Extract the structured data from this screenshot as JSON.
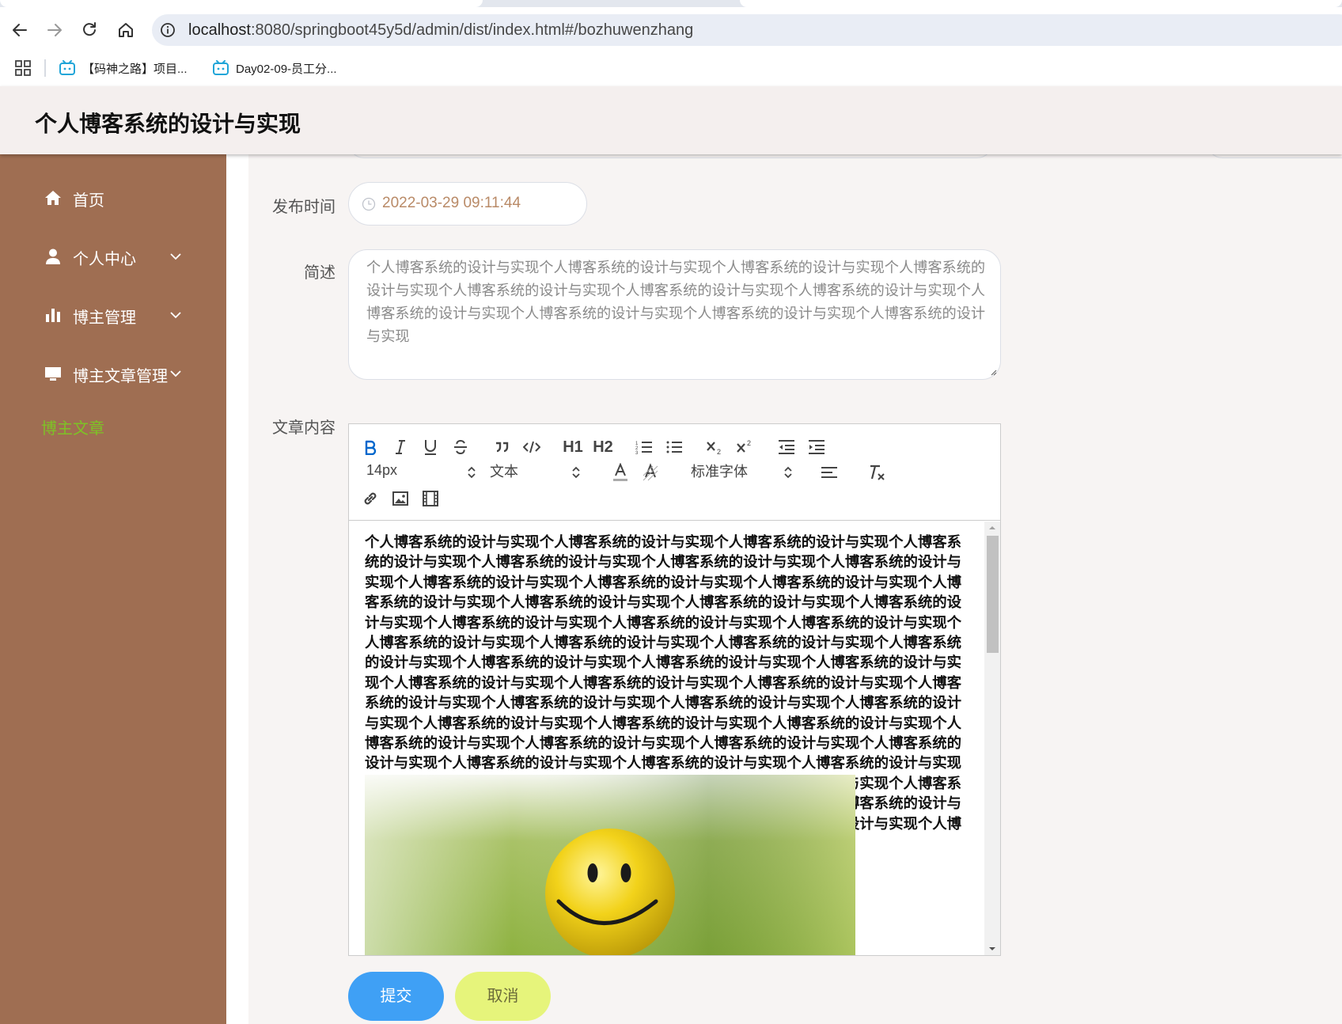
{
  "browser": {
    "url_host": "localhost",
    "url_rest": ":8080/springboot45y5d/admin/dist/index.html#/bozhuwenzhang",
    "bookmarks": [
      {
        "label": "【码神之路】项目..."
      },
      {
        "label": "Day02-09-员工分..."
      }
    ]
  },
  "header": {
    "title": "个人博客系统的设计与实现"
  },
  "sidebar": {
    "items": [
      {
        "label": "首页",
        "icon": "home-icon"
      },
      {
        "label": "个人中心",
        "icon": "user-icon"
      },
      {
        "label": "博主管理",
        "icon": "bar-chart-icon"
      },
      {
        "label": "博主文章管理",
        "icon": "monitor-icon"
      }
    ],
    "active_subitem": "博主文章",
    "active_color": "#7ec226",
    "background": "#9f6e52"
  },
  "form": {
    "publish_time": {
      "label": "发布时间",
      "value": "2022-03-29 09:11:44"
    },
    "summary": {
      "label": "简述",
      "value": "个人博客系统的设计与实现个人博客系统的设计与实现个人博客系统的设计与实现个人博客系统的设计与实现个人博客系统的设计与实现个人博客系统的设计与实现个人博客系统的设计与实现个人博客系统的设计与实现个人博客系统的设计与实现个人博客系统的设计与实现个人博客系统的设计与实现"
    },
    "content": {
      "label": "文章内容",
      "toolbar": {
        "font_size": "14px",
        "header_select": "文本",
        "font_family": "标准字体",
        "h1": "H1",
        "h2": "H2"
      },
      "body_text": "个人博客系统的设计与实现个人博客系统的设计与实现个人博客系统的设计与实现个人博客系统的设计与实现个人博客系统的设计与实现个人博客系统的设计与实现个人博客系统的设计与实现个人博客系统的设计与实现个人博客系统的设计与实现个人博客系统的设计与实现个人博客系统的设计与实现个人博客系统的设计与实现个人博客系统的设计与实现个人博客系统的设计与实现个人博客系统的设计与实现个人博客系统的设计与实现个人博客系统的设计与实现个人博客系统的设计与实现个人博客系统的设计与实现个人博客系统的设计与实现个人博客系统的设计与实现个人博客系统的设计与实现个人博客系统的设计与实现个人博客系统的设计与实现个人博客系统的设计与实现个人博客系统的设计与实现个人博客系统的设计与实现个人博客系统的设计与实现个人博客系统的设计与实现个人博客系统的设计与实现个人博客系统的设计与实现个人博客系统的设计与实现个人博客系统的设计与实现个人博客系统的设计与实现个人博客系统的设计与实现个人博客系统的设计与实现个人博客系统的设计与实现个人博客系统的设计与实现个人博客系统的设计与实现个人博客系统的设计与实现个人博客系统的设计与实现个人博客系统的设计与实现个人博客系统的设计与实现个人博客系统的设计与实现个人博客系统的设计与实现个人博客系统的设计与实现个人博客系统的设计与实现个人博客系统的设计与实现个人博客系统的设计与实现个人博客系统的设计与实现个人博客系统的设计与实现个人博客系统的设计与实现",
      "image": "smiley-golf-ball-image"
    },
    "buttons": {
      "submit": "提交",
      "cancel": "取消",
      "submit_color": "#3fa0f5",
      "cancel_color": "#e6f47b"
    }
  }
}
